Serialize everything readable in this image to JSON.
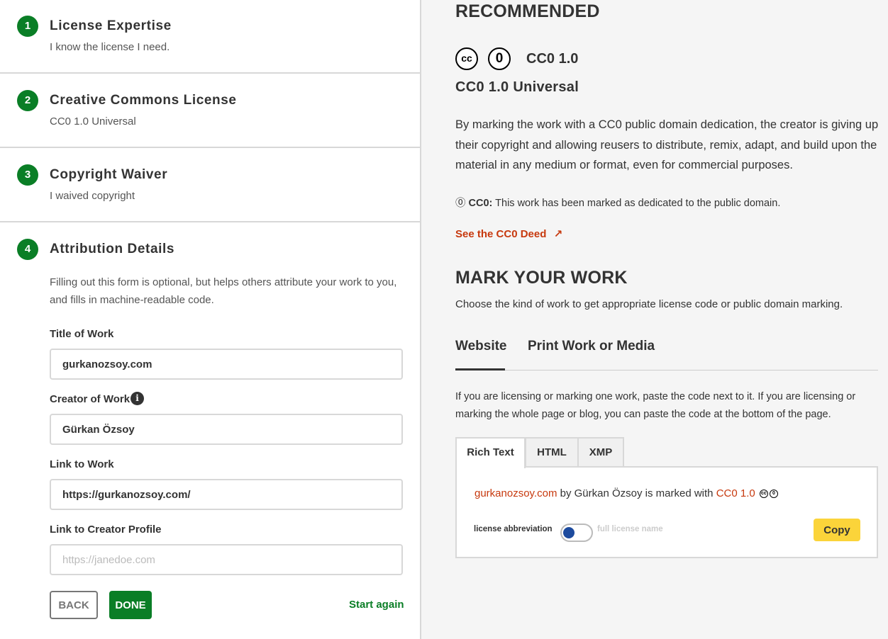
{
  "steps": [
    {
      "num": "1",
      "title": "License Expertise",
      "subtitle": "I know the license I need."
    },
    {
      "num": "2",
      "title": "Creative Commons License",
      "subtitle": "CC0 1.0 Universal"
    },
    {
      "num": "3",
      "title": "Copyright Waiver",
      "subtitle": "I waived copyright"
    },
    {
      "num": "4",
      "title": "Attribution Details",
      "subtitle": ""
    }
  ],
  "attribution": {
    "intro": "Filling out this form is optional, but helps others attribute your work to you, and fills in machine-readable code.",
    "title_label": "Title of Work",
    "title_value": "gurkanozsoy.com",
    "creator_label": "Creator of Work",
    "creator_value": "Gürkan Özsoy",
    "link_label": "Link to Work",
    "link_value": "https://gurkanozsoy.com/",
    "profile_label": "Link to Creator Profile",
    "profile_placeholder": "https://janedoe.com",
    "info_icon": "i"
  },
  "buttons": {
    "back": "BACK",
    "done": "DONE",
    "start_again": "Start again"
  },
  "recommended": {
    "heading": "RECOMMENDED",
    "badge_cc": "cc",
    "badge_zero": "0",
    "short_name": "CC0 1.0",
    "full_name": "CC0 1.0 Universal",
    "description": "By marking the work with a CC0 public domain dedication, the creator is giving up their copyright and allowing reusers to distribute, remix, adapt, and build upon the material in any medium or format, even for commercial purposes.",
    "mark_symbol": "⓪",
    "mark_label": "CC0:",
    "mark_text": "This work has been marked as dedicated to the public domain.",
    "deed_link": "See the CC0 Deed",
    "deed_icon": "↗"
  },
  "mark_your_work": {
    "heading": "MARK YOUR WORK",
    "description": "Choose the kind of work to get appropriate license code or public domain marking.",
    "tabs": [
      "Website",
      "Print Work or Media"
    ],
    "paste_desc": "If you are licensing or marking one work, paste the code next to it. If you are licensing or marking the whole page or blog, you can paste the code at the bottom of the page.",
    "code_tabs": [
      "Rich Text",
      "HTML",
      "XMP"
    ],
    "attribution_text": {
      "work": "gurkanozsoy.com",
      "by": " by Gürkan Özsoy is marked with ",
      "license": "CC0 1.0"
    },
    "toggle_left": "license abbreviation",
    "toggle_right": "full license name",
    "copy": "Copy"
  },
  "colors": {
    "green": "#0a7e26",
    "orange": "#c7390e",
    "yellow": "#fbd43a",
    "navy": "#1d4b9e"
  }
}
